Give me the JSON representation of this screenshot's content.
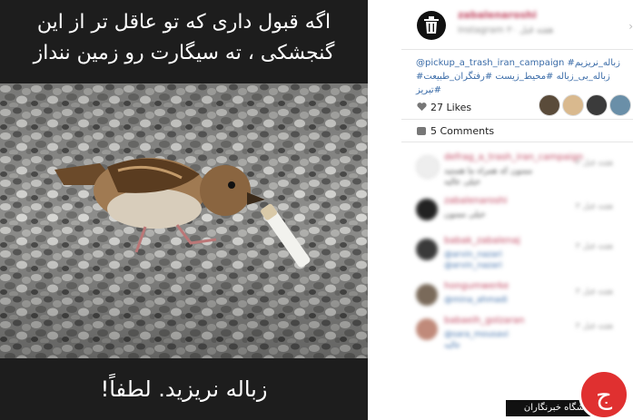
{
  "image_post": {
    "caption_top_line1": "اگه قبول داری که تو عاقل تر از این",
    "caption_top_line2": "گنجشکی ، ته سیگارت رو زمین ننداز",
    "caption_bottom": "زباله نریزید. لطفاً!"
  },
  "post": {
    "username": "zabalenaroshi",
    "subline": "Instagram ۳۰ هفته قبل",
    "hashtags": [
      "@pickup_a_trash_iran_campaign #زباله_نریزیم",
      "#زباله_بی_زباله #محیط_زیست #رفتگران_طبیعت #تبریز"
    ],
    "likes": "27 Likes",
    "comments_count": "5 Comments",
    "comments": [
      {
        "name": "defrag_a_trash_iran_campaign",
        "text": "ممنون که همراه ما هستید",
        "text2": "خیلی عالیه",
        "time": "۳ هفته قبل"
      },
      {
        "name": "zabalenaroshi",
        "text": "خیلی ممنون",
        "text2": "",
        "time": "۳ هفته قبل"
      },
      {
        "name": "babak_zabalenaj",
        "text": "@arvin_nazari",
        "text2": "@arvin_nazari",
        "time": "۳ هفته قبل"
      },
      {
        "name": "hongumwerke",
        "text": "@mina_ahmadi",
        "text2": "",
        "time": "۳ هفته قبل"
      },
      {
        "name": "babaeih_golzaran",
        "text": "@sara_mousavi",
        "text2": "عالیه",
        "time": "۳ هفته قبل"
      }
    ]
  },
  "watermark": {
    "label": "باشگاه خبرنگاران",
    "logo_glyph": "ج"
  },
  "colors": {
    "photo_band": "#1d1d1d",
    "username": "#c0455f",
    "hashtag": "#3b6ca8",
    "watermark_red": "#e03030"
  }
}
